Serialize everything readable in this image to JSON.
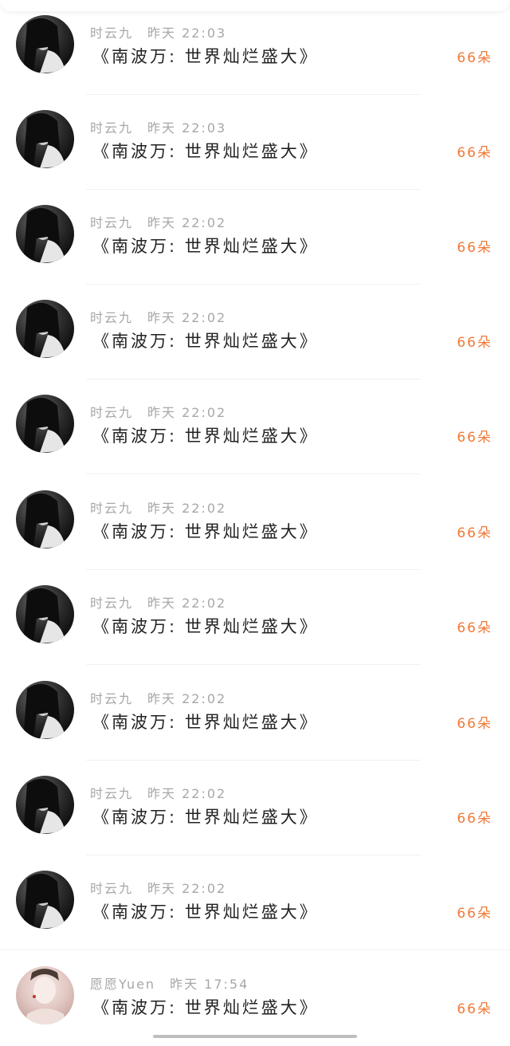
{
  "gift_color": "#f07a37",
  "items": [
    {
      "user": "时云九",
      "time": "昨天 22:03",
      "message": "《南波万: 世界灿烂盛大》",
      "gift": "66朵",
      "avatar_icon": "dark-portrait-avatar"
    },
    {
      "user": "时云九",
      "time": "昨天 22:03",
      "message": "《南波万: 世界灿烂盛大》",
      "gift": "66朵",
      "avatar_icon": "dark-portrait-avatar"
    },
    {
      "user": "时云九",
      "time": "昨天 22:02",
      "message": "《南波万: 世界灿烂盛大》",
      "gift": "66朵",
      "avatar_icon": "dark-portrait-avatar"
    },
    {
      "user": "时云九",
      "time": "昨天 22:02",
      "message": "《南波万: 世界灿烂盛大》",
      "gift": "66朵",
      "avatar_icon": "dark-portrait-avatar"
    },
    {
      "user": "时云九",
      "time": "昨天 22:02",
      "message": "《南波万: 世界灿烂盛大》",
      "gift": "66朵",
      "avatar_icon": "dark-portrait-avatar"
    },
    {
      "user": "时云九",
      "time": "昨天 22:02",
      "message": "《南波万: 世界灿烂盛大》",
      "gift": "66朵",
      "avatar_icon": "dark-portrait-avatar"
    },
    {
      "user": "时云九",
      "time": "昨天 22:02",
      "message": "《南波万: 世界灿烂盛大》",
      "gift": "66朵",
      "avatar_icon": "dark-portrait-avatar"
    },
    {
      "user": "时云九",
      "time": "昨天 22:02",
      "message": "《南波万: 世界灿烂盛大》",
      "gift": "66朵",
      "avatar_icon": "dark-portrait-avatar"
    },
    {
      "user": "时云九",
      "time": "昨天 22:02",
      "message": "《南波万: 世界灿烂盛大》",
      "gift": "66朵",
      "avatar_icon": "dark-portrait-avatar"
    },
    {
      "user": "时云九",
      "time": "昨天 22:02",
      "message": "《南波万: 世界灿烂盛大》",
      "gift": "66朵",
      "avatar_icon": "dark-portrait-avatar"
    },
    {
      "user": "愿愿Yuen",
      "time": "昨天 17:54",
      "message": "《南波万: 世界灿烂盛大》",
      "gift": "66朵",
      "avatar_icon": "light-portrait-avatar"
    }
  ]
}
